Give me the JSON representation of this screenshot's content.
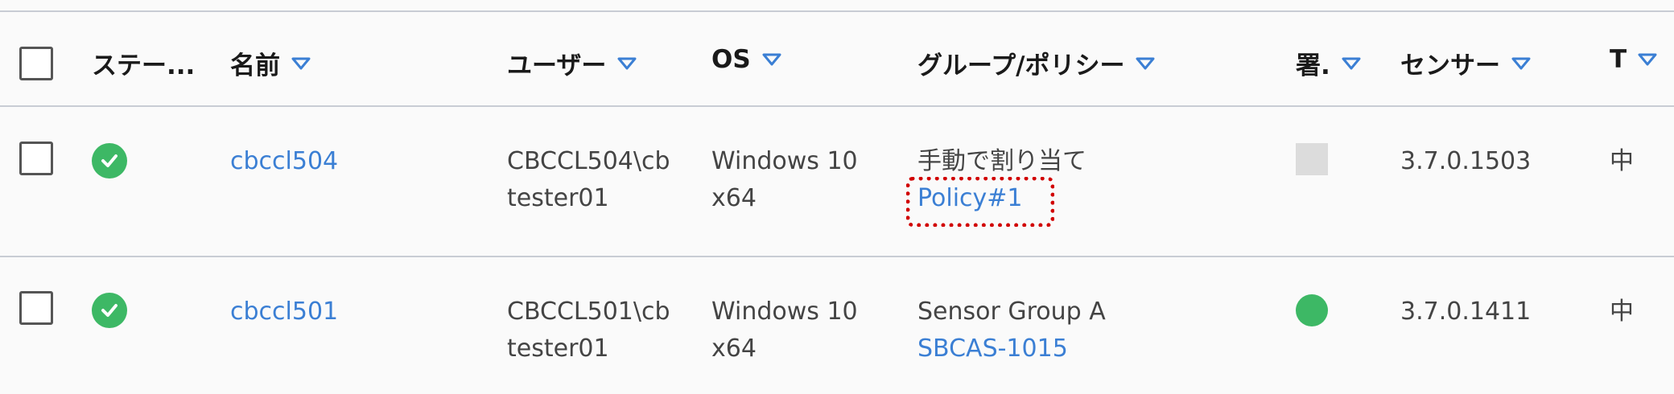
{
  "columns": {
    "status": "ステー...",
    "name": "名前",
    "user": "ユーザー",
    "os": "OS",
    "group_policy": "グループ/ポリシー",
    "signature": "署.",
    "sensor": "センサー",
    "t": "T"
  },
  "rows": [
    {
      "name": "cbccl504",
      "user_line1": "CBCCL504\\cb",
      "user_line2": "tester01",
      "os_line1": "Windows 10",
      "os_line2": "x64",
      "group": "手動で割り当て",
      "policy": "Policy#1",
      "signature_state": "gray",
      "sensor": "3.7.0.1503",
      "t": "中"
    },
    {
      "name": "cbccl501",
      "user_line1": "CBCCL501\\cb",
      "user_line2": "tester01",
      "os_line1": "Windows 10",
      "os_line2": "x64",
      "group": "Sensor Group A",
      "policy": "SBCAS-1015",
      "signature_state": "green",
      "sensor": "3.7.0.1411",
      "t": "中"
    }
  ],
  "colors": {
    "accent_link": "#3b7fd4",
    "status_green": "#3db865",
    "highlight_red": "#d10000"
  }
}
